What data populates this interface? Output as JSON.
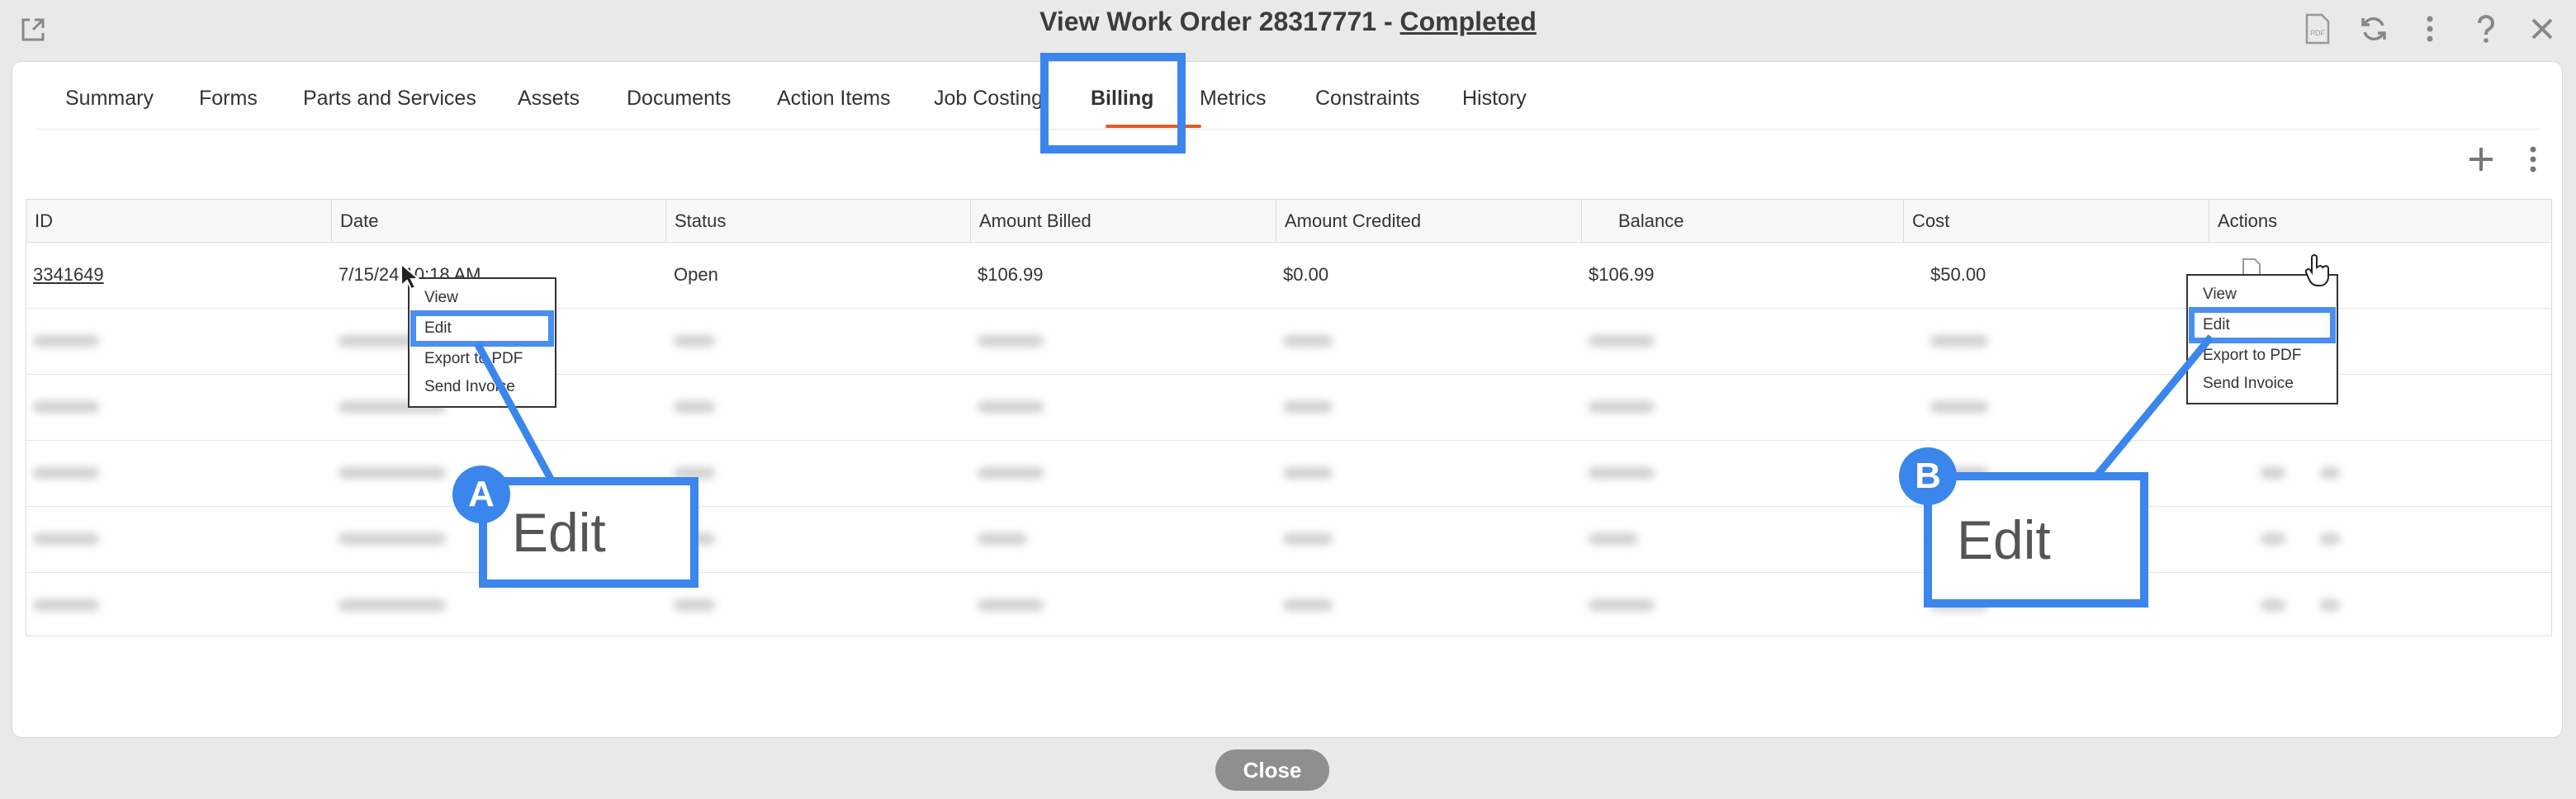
{
  "window": {
    "title_prefix": "View Work Order  28317771  -",
    "status": "Completed"
  },
  "icons": {
    "external": "external-link-icon",
    "pdf": "pdf-icon",
    "refresh": "refresh-icon",
    "more": "more-vertical-icon",
    "help": "help-icon",
    "close": "close-icon",
    "add": "plus-icon",
    "cursor": "mouse-cursor-icon",
    "hand": "hand-pointer-icon"
  },
  "tabs": [
    {
      "label": "Summary"
    },
    {
      "label": "Forms"
    },
    {
      "label": "Parts and Services"
    },
    {
      "label": "Assets"
    },
    {
      "label": "Documents"
    },
    {
      "label": "Action Items"
    },
    {
      "label": "Job Costing"
    },
    {
      "label": "Billing"
    },
    {
      "label": "Metrics"
    },
    {
      "label": "Constraints"
    },
    {
      "label": "History"
    }
  ],
  "active_tab": "Billing",
  "table": {
    "columns": [
      "ID",
      "Date",
      "Status",
      "Amount Billed",
      "Amount Credited",
      "Balance",
      "Cost",
      "Actions"
    ],
    "rows": [
      {
        "id": "3341649",
        "date": "7/15/24 10:18 AM",
        "status": "Open",
        "billed": "$106.99",
        "credited": "$0.00",
        "balance": "$106.99",
        "cost": "$50.00"
      }
    ]
  },
  "menu": {
    "items": [
      "View",
      "Edit",
      "Export to PDF",
      "Send Invoice"
    ]
  },
  "callouts": {
    "a": {
      "badge": "A",
      "label": "Edit"
    },
    "b": {
      "badge": "B",
      "label": "Edit"
    }
  },
  "footer": {
    "close_label": "Close"
  },
  "colors": {
    "accent": "#3b86ec",
    "tab_underline": "#e45b28"
  }
}
